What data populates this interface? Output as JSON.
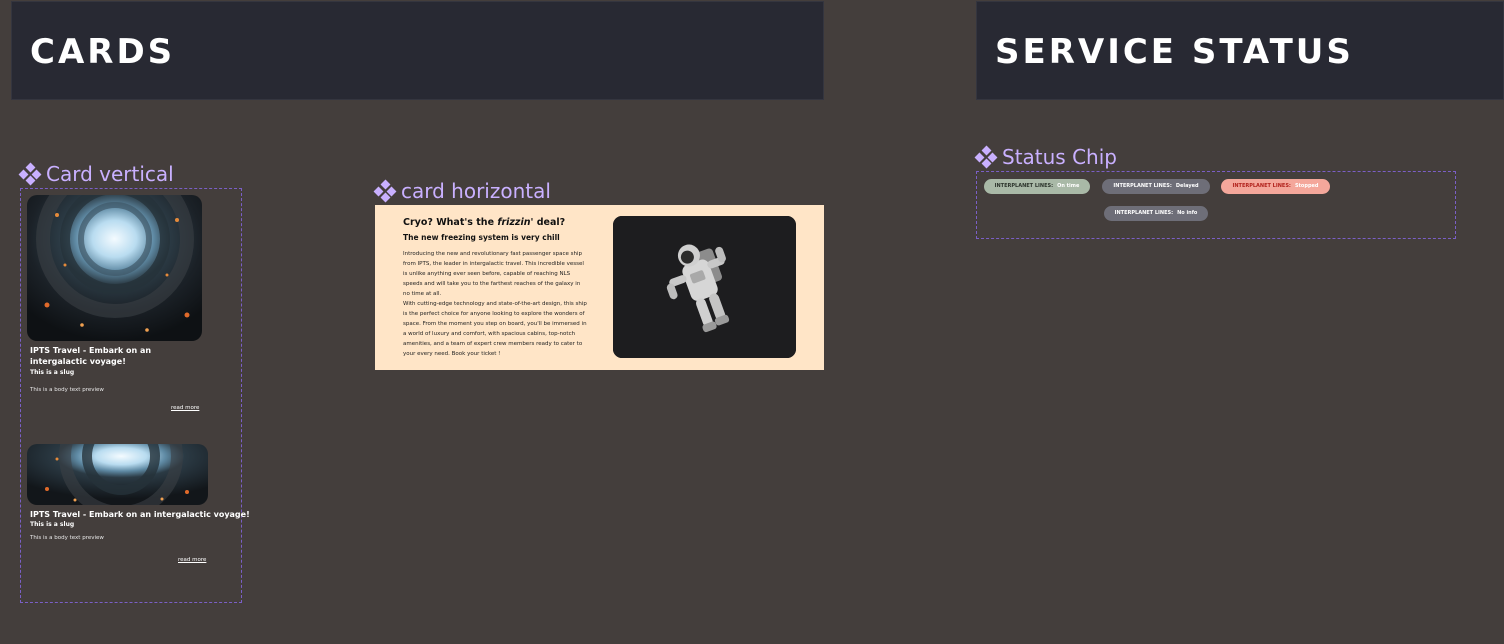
{
  "banners": {
    "cards": "CARDS",
    "service_status": "SERVICE STATUS"
  },
  "components": {
    "card_vertical": "Card vertical",
    "card_horizontal": "card horizontal",
    "status_chip": "Status Chip"
  },
  "icons": {
    "component": "component-diamond-icon",
    "astronaut": "astronaut-image",
    "space_station": "space-station-image"
  },
  "vertical_cards": [
    {
      "title": "IPTS Travel - Embark on an intergalactic voyage!",
      "slug": "This is a slug",
      "body": "This is a body text preview",
      "link": "read more"
    },
    {
      "title": "IPTS Travel - Embark on an intergalactic voyage!",
      "slug": "This is a slug",
      "body": "This is a body text preview",
      "link": "read more"
    }
  ],
  "horizontal_card": {
    "title_start": "Cryo? What's the ",
    "title_em": "frizzin'",
    "title_end": " deal?",
    "subtitle": "The new freezing system is very chill",
    "body_1": "Introducing the new and revolutionary fast passenger space ship from IPTS, the leader in intergalactic travel. This incredible vessel is unlike anything ever seen before, capable of reaching NLS speeds and will take you to the farthest reaches of the galaxy in no time at all.",
    "body_2": "With cutting-edge technology and state-of-the-art design, this ship is the perfect choice for anyone looking to explore the wonders of space. From the moment you step on board, you'll be immersed in a world of luxury and comfort, with spacious cabins, top-notch amenities, and a team of expert crew members ready to cater to your every need. Book your ticket !"
  },
  "status_chips": [
    {
      "label": "INTERPLANET LINES:",
      "status": "On time",
      "bg": "#a9b9a7",
      "label_color": "#2b332b",
      "status_color": "#ffffff"
    },
    {
      "label": "INTERPLANET LINES:",
      "status": "Delayed",
      "bg": "#6e6e78",
      "label_color": "#ffffff",
      "status_color": "#ffffff"
    },
    {
      "label": "INTERPLANET LINES:",
      "status": "Stopped",
      "bg": "#f4a79b",
      "label_color": "#b1221c",
      "status_color": "#ffffff"
    },
    {
      "label": "INTERPLANET LINES:",
      "status": "No info",
      "bg": "#6e6e78",
      "label_color": "#ffffff",
      "status_color": "#ffffff"
    }
  ],
  "colors": {
    "background": "#443e3c",
    "banner": "#282933",
    "accent": "#c9b0ff",
    "dashed_border": "#7b5fc6",
    "card_horizontal_bg": "#ffe5c7"
  }
}
